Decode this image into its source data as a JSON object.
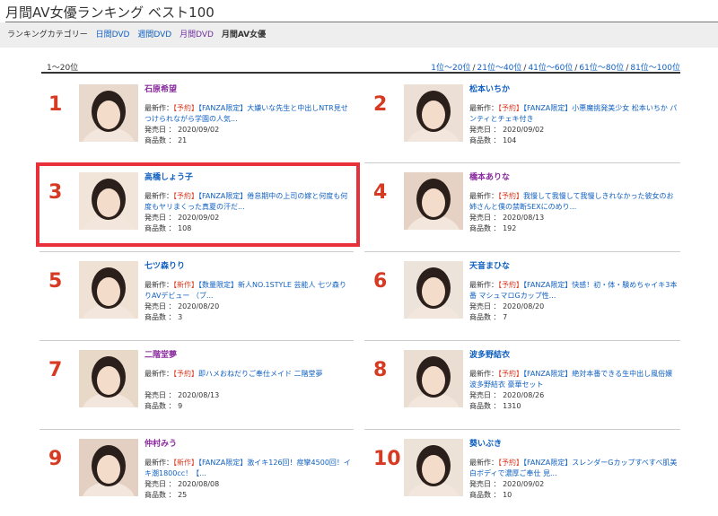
{
  "page": {
    "title": "月間AV女優ランキング ベスト100"
  },
  "categories": {
    "label": "ランキングカテゴリー",
    "items": [
      {
        "text": "日間DVD",
        "style": "link"
      },
      {
        "text": "週間DVD",
        "style": "link"
      },
      {
        "text": "月間DVD",
        "style": "purple"
      },
      {
        "text": "月間AV女優",
        "style": "current"
      }
    ]
  },
  "range": {
    "current": "1〜20位",
    "pages": [
      "1位〜20位",
      "21位〜40位",
      "41位〜60位",
      "61位〜80位",
      "81位〜100位"
    ]
  },
  "labels": {
    "latest": "最新作：",
    "release": "発売日 ：",
    "count": "商品数 ："
  },
  "entries": [
    {
      "rank": "1",
      "name": "石原希望",
      "name_color": "purple",
      "tag": "【予約】",
      "work": "【FANZA限定】大嫌いな先生と中出しNTR見せつけられながら学園の人気...",
      "date": "2020/09/02",
      "count": "21",
      "photo": "#e9d9cc"
    },
    {
      "rank": "2",
      "name": "松本いちか",
      "name_color": "blue",
      "tag": "【予約】",
      "work": "【FANZA限定】小悪魔挑発美少女 松本いちか パンティとチェキ付き",
      "date": "2020/09/02",
      "count": "104",
      "photo": "#ece0d6"
    },
    {
      "rank": "3",
      "name": "高橋しょう子",
      "name_color": "blue",
      "tag": "【予約】",
      "work": "【FANZA限定】倦怠期中の上司の嫁と何度も何度もヤリまくった真夏の汗だ...",
      "date": "2020/09/02",
      "count": "108",
      "photo": "#f1e4d9"
    },
    {
      "rank": "4",
      "name": "橋本ありな",
      "name_color": "purple",
      "tag": "【予約】",
      "work": "我慢して我慢して我慢しきれなかった彼女のお姉さんと僕の禁断SEXにのめり...",
      "date": "2020/08/13",
      "count": "192",
      "photo": "#e6d2c4"
    },
    {
      "rank": "5",
      "name": "七ツ森りり",
      "name_color": "blue",
      "tag": "【新作】",
      "work": "【数量限定】新人NO.1STYLE 芸能人 七ツ森りりAVデビュー （ブ...",
      "date": "2020/08/20",
      "count": "3",
      "photo": "#efe1d3"
    },
    {
      "rank": "6",
      "name": "天音まひな",
      "name_color": "blue",
      "tag": "【予約】",
      "work": "【FANZA限定】快感！初・体・験めちゃイキ3本番 マシュマロGカップ性...",
      "date": "2020/08/20",
      "count": "7",
      "photo": "#ece3da"
    },
    {
      "rank": "7",
      "name": "二階堂夢",
      "name_color": "purple",
      "tag": "【予約】",
      "work": "即ハメおねだりご奉仕メイド 二階堂夢",
      "date": "2020/08/13",
      "count": "9",
      "photo": "#e8d8c8"
    },
    {
      "rank": "8",
      "name": "波多野結衣",
      "name_color": "blue",
      "tag": "【予約】",
      "work": "【FANZA限定】絶対本番できる生中出し風俗嬢 波多野結衣 豪華セット",
      "date": "2020/08/26",
      "count": "1310",
      "photo": "#eaddd2"
    },
    {
      "rank": "9",
      "name": "仲村みう",
      "name_color": "purple",
      "tag": "【新作】",
      "work": "【FANZA限定】激イキ126回！痙攣4500回！イキ潮1800cc！【...",
      "date": "2020/08/08",
      "count": "25",
      "photo": "#e3d0c2"
    },
    {
      "rank": "10",
      "name": "葵いぶき",
      "name_color": "blue",
      "tag": "【予約】",
      "work": "【FANZA限定】スレンダーGカップすべすべ肌美白ボディで濃厚ご奉仕 見...",
      "date": "2020/09/02",
      "count": "10",
      "photo": "#ede2d8"
    }
  ],
  "colors": {
    "rank": "#d73a22",
    "link": "#1060c0",
    "purple_link": "#8a2a9e",
    "highlight": "#e8303a"
  }
}
